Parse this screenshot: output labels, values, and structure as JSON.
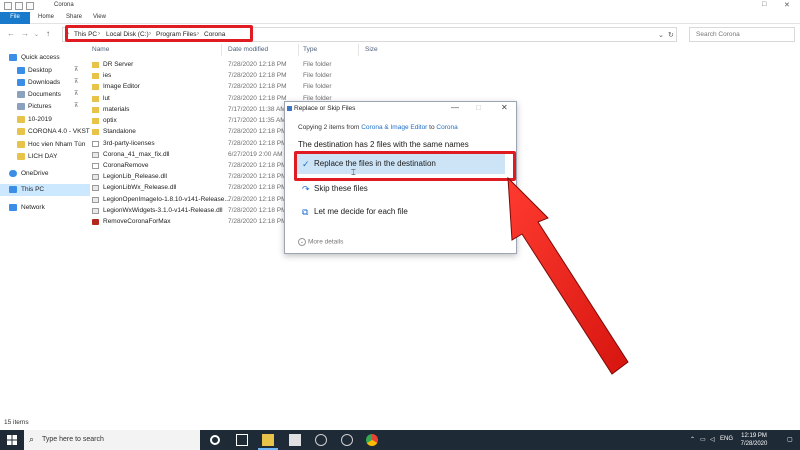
{
  "window": {
    "title": "Corona"
  },
  "ribbon": {
    "tabs": [
      "File",
      "Home",
      "Share",
      "View"
    ]
  },
  "address": {
    "crumbs": [
      "This PC",
      "Local Disk (C:)",
      "Program Files",
      "Corona"
    ],
    "search_placeholder": "Search Corona"
  },
  "columns": {
    "name": "Name",
    "date": "Date modified",
    "type": "Type",
    "size": "Size"
  },
  "nav": {
    "items": [
      {
        "label": "Quick access",
        "color": "#3b8ee6"
      },
      {
        "label": "Desktop",
        "color": "#3b8ee6",
        "pinned": true
      },
      {
        "label": "Downloads",
        "color": "#3b8ee6",
        "pinned": true
      },
      {
        "label": "Documents",
        "color": "#8aa2be",
        "pinned": true
      },
      {
        "label": "Pictures",
        "color": "#8aa2be",
        "pinned": true
      },
      {
        "label": "10-2019",
        "color": "#e8c34a"
      },
      {
        "label": "CORONA 4.0 - VKST",
        "color": "#e8c34a"
      },
      {
        "label": "Hoc vien Nham Tùn",
        "color": "#e8c34a"
      },
      {
        "label": "LICH DAY",
        "color": "#e8c34a"
      },
      {
        "label": "OneDrive",
        "color": "#3b8ee6"
      },
      {
        "label": "This PC",
        "color": "#3b8ee6"
      },
      {
        "label": "Network",
        "color": "#3b8ee6"
      }
    ],
    "pin_glyph": "⊼"
  },
  "files": [
    {
      "name": "DR Server",
      "date": "7/28/2020 12:18 PM",
      "type": "File folder",
      "icon": "folder"
    },
    {
      "name": "ies",
      "date": "7/28/2020 12:18 PM",
      "type": "File folder",
      "icon": "folder"
    },
    {
      "name": "Image Editor",
      "date": "7/28/2020 12:18 PM",
      "type": "File folder",
      "icon": "folder"
    },
    {
      "name": "lut",
      "date": "7/28/2020 12:18 PM",
      "type": "File folder",
      "icon": "folder"
    },
    {
      "name": "materials",
      "date": "7/17/2020 11:38 AM",
      "type": "File folder",
      "icon": "folder"
    },
    {
      "name": "optix",
      "date": "7/17/2020 11:35 AM",
      "type": "File folder",
      "icon": "folder"
    },
    {
      "name": "Standalone",
      "date": "7/28/2020 12:18 PM",
      "type": "File folder",
      "icon": "folder"
    },
    {
      "name": "3rd-party-licenses",
      "date": "7/28/2020 12:18 PM",
      "type": "File folder",
      "icon": "doc"
    },
    {
      "name": "Corona_41_max_fix.dll",
      "date": "6/27/2019 2:00 AM",
      "type": "",
      "icon": "dll"
    },
    {
      "name": "CoronaRemove",
      "date": "7/28/2020 12:18 PM",
      "type": "",
      "icon": "doc"
    },
    {
      "name": "LegionLib_Release.dll",
      "date": "7/28/2020 12:18 PM",
      "type": "",
      "icon": "dll"
    },
    {
      "name": "LegionLibWx_Release.dll",
      "date": "7/28/2020 12:18 PM",
      "type": "",
      "icon": "dll"
    },
    {
      "name": "LegionOpenImageIo-1.8.10-v141-Release...",
      "date": "7/28/2020 12:18 PM",
      "type": "",
      "icon": "dll"
    },
    {
      "name": "LegionWxWidgets-3.1.0-v141-Release.dll",
      "date": "7/28/2020 12:18 PM",
      "type": "",
      "icon": "dll"
    },
    {
      "name": "RemoveCoronaForMax",
      "date": "7/28/2020 12:18 PM",
      "type": "",
      "icon": "app"
    }
  ],
  "status": {
    "items_count": "15 items"
  },
  "dialog": {
    "title": "Replace or Skip Files",
    "copy_prefix": "Copying 2 items from",
    "copy_source": "Corona & Image Editor",
    "copy_to": "to",
    "copy_dest": "Corona",
    "heading": "The destination has 2 files with the same names",
    "options": [
      {
        "label": "Replace the files in the destination",
        "glyph": "✓"
      },
      {
        "label": "Skip these files",
        "glyph": "↷"
      },
      {
        "label": "Let me decide for each file",
        "glyph": "⧉"
      }
    ],
    "more_details": "More details",
    "more_glyph": "⌄",
    "controls": {
      "minimize": "—",
      "maximize": "□",
      "close": "✕"
    }
  },
  "taskbar": {
    "search_placeholder": "Type here to search",
    "tray_lang": "ENG",
    "time": "12:19 PM",
    "date": "7/28/2020"
  },
  "colors": {
    "accent": "#1979ca",
    "highlight_red": "#e01b22",
    "selection": "#cde4f7",
    "taskbar": "#1f2a37"
  }
}
